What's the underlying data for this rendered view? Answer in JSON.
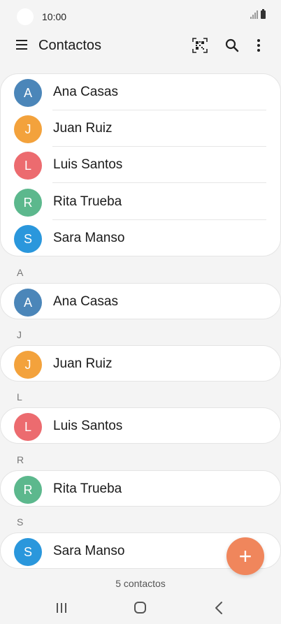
{
  "status": {
    "time": "10:00"
  },
  "header": {
    "title": "Contactos",
    "icons": [
      "menu-icon",
      "qr-code-icon",
      "search-icon",
      "more-vert-icon"
    ]
  },
  "favorites": [
    {
      "initial": "A",
      "name": "Ana Casas",
      "color": "#4b86b9"
    },
    {
      "initial": "J",
      "name": "Juan Ruiz",
      "color": "#f3a23c"
    },
    {
      "initial": "L",
      "name": "Luis Santos",
      "color": "#ec6b6f"
    },
    {
      "initial": "R",
      "name": "Rita Trueba",
      "color": "#5cb88d"
    },
    {
      "initial": "S",
      "name": "Sara Manso",
      "color": "#2a97dc"
    }
  ],
  "sections": [
    {
      "letter": "A",
      "contact": {
        "initial": "A",
        "name": "Ana Casas",
        "color": "#4b86b9"
      }
    },
    {
      "letter": "J",
      "contact": {
        "initial": "J",
        "name": "Juan Ruiz",
        "color": "#f3a23c"
      }
    },
    {
      "letter": "L",
      "contact": {
        "initial": "L",
        "name": "Luis Santos",
        "color": "#ec6b6f"
      }
    },
    {
      "letter": "R",
      "contact": {
        "initial": "R",
        "name": "Rita Trueba",
        "color": "#5cb88d"
      }
    },
    {
      "letter": "S",
      "contact": {
        "initial": "S",
        "name": "Sara Manso",
        "color": "#2a97dc"
      }
    }
  ],
  "fab": {
    "label": "+"
  },
  "footer": {
    "count": "5 contactos"
  },
  "colors": {
    "background": "#f4f4f4",
    "fab": "#f0865c"
  }
}
